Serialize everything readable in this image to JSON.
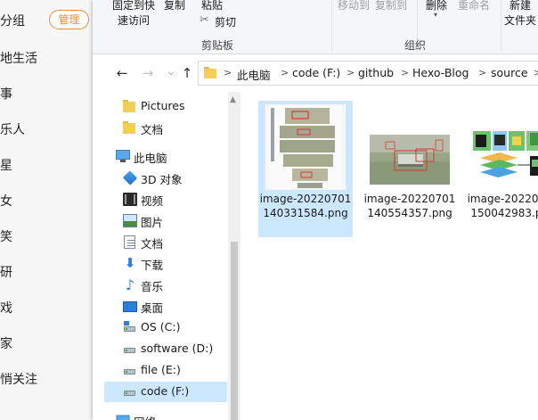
{
  "background_app": {
    "group_title": "分组",
    "manage_button": "管理",
    "items": [
      "地生活",
      "事",
      "乐人",
      "星",
      "女",
      "笑",
      "研",
      "戏",
      "家",
      "悄关注"
    ]
  },
  "ribbon": {
    "pin_quick_access_line1": "固定到快",
    "pin_quick_access_line2": "速访问",
    "copy": "复制",
    "paste": "粘贴",
    "cut": "剪切",
    "move_to": "移动到",
    "copy_to": "复制到",
    "delete": "删除",
    "rename": "重命名",
    "new_folder_line1": "新建",
    "new_folder_line2": "文件夹",
    "group_clipboard": "剪贴板",
    "group_organize": "组织"
  },
  "address": {
    "crumbs": [
      "此电脑",
      "code (F:)",
      "github",
      "Hexo-Blog",
      "source"
    ]
  },
  "nav_tree": [
    {
      "label": "Pictures",
      "icon": "folder-icon"
    },
    {
      "label": "文档",
      "icon": "folder-icon"
    },
    {
      "label": "此电脑",
      "icon": "computer-icon"
    },
    {
      "label": "3D 对象",
      "icon": "3d-objects-icon"
    },
    {
      "label": "视频",
      "icon": "video-icon"
    },
    {
      "label": "图片",
      "icon": "pictures-icon"
    },
    {
      "label": "文档",
      "icon": "documents-icon"
    },
    {
      "label": "下载",
      "icon": "download-icon"
    },
    {
      "label": "音乐",
      "icon": "music-icon"
    },
    {
      "label": "桌面",
      "icon": "desktop-icon"
    },
    {
      "label": "OS (C:)",
      "icon": "windows-drive-icon"
    },
    {
      "label": "software (D:)",
      "icon": "drive-icon"
    },
    {
      "label": "file (E:)",
      "icon": "drive-icon"
    },
    {
      "label": "code (F:)",
      "icon": "drive-icon"
    },
    {
      "label": "网络",
      "icon": "network-icon"
    }
  ],
  "files": [
    {
      "name": "image-20220701140331584.png",
      "selected": true
    },
    {
      "name": "image-20220701140554357.png",
      "selected": false
    },
    {
      "name": "image-20220701150042983.png",
      "selected": false
    }
  ],
  "colors": {
    "selection": "#cce8ff",
    "manage_accent": "#f08a3c",
    "folder": "#f4cd58"
  }
}
